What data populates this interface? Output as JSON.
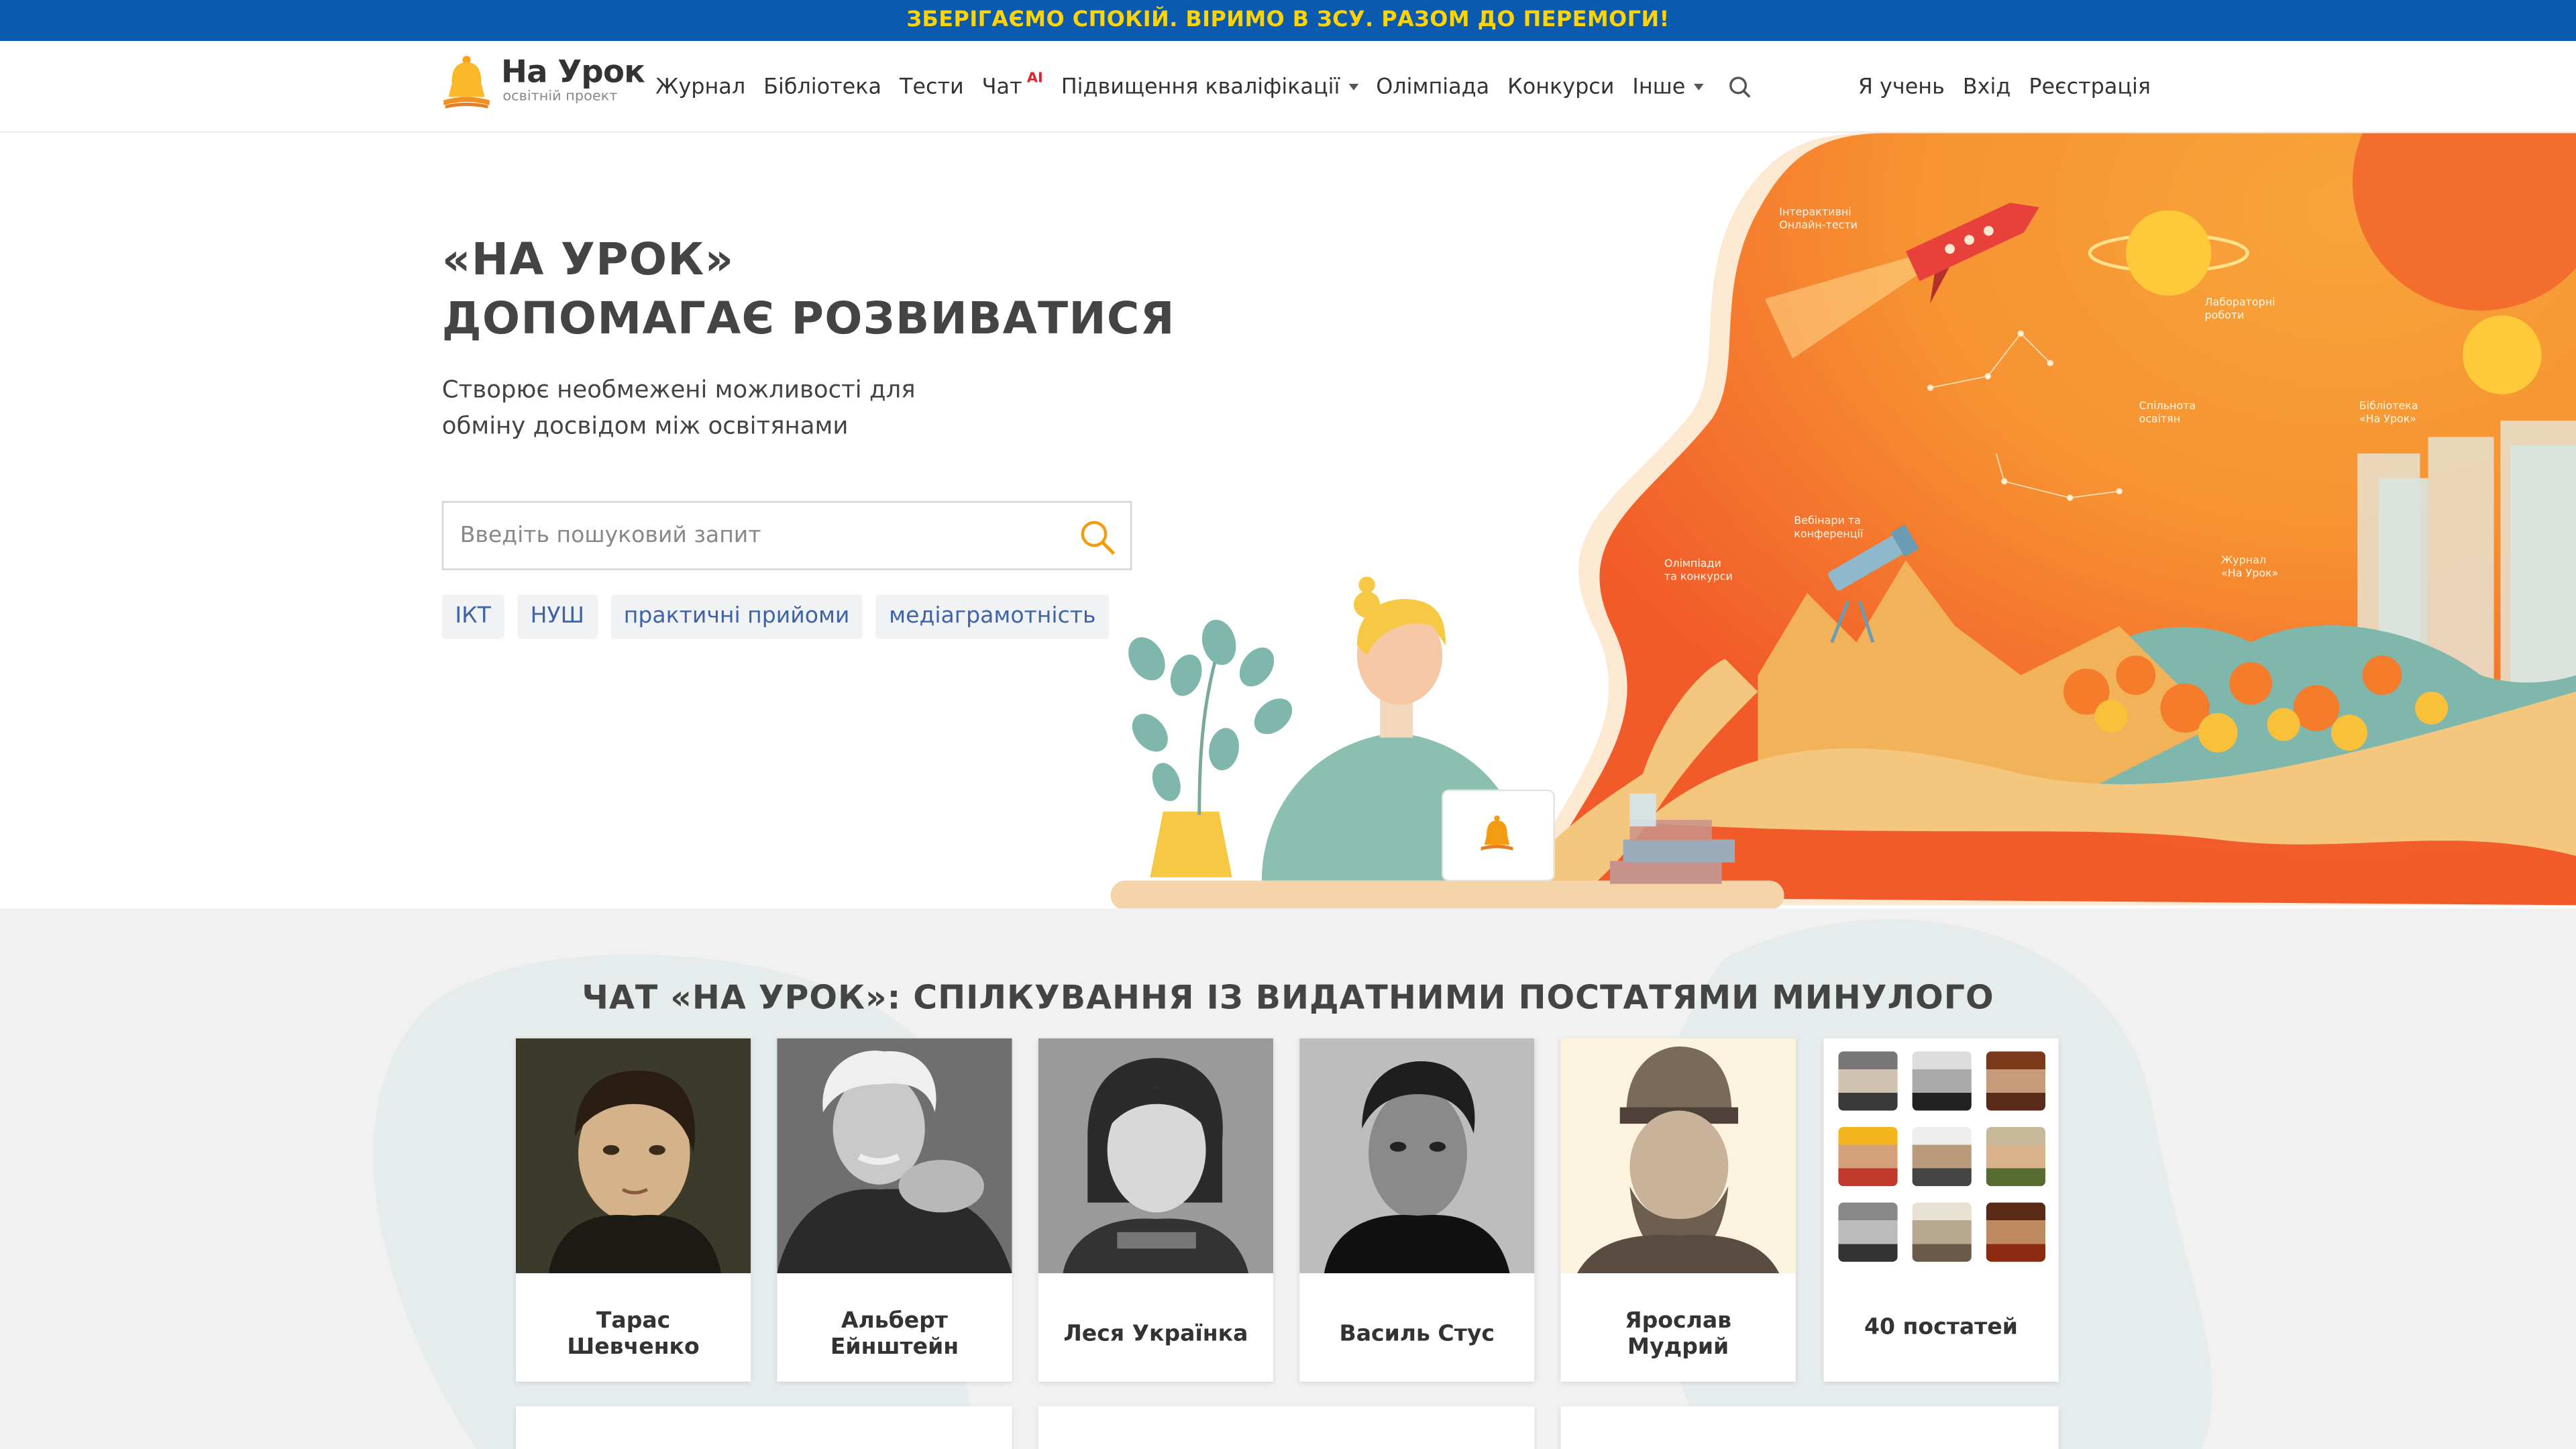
{
  "banner": {
    "text": "ЗБЕРІГАЄМО СПОКІЙ. ВІРИМО В ЗСУ. РАЗОМ ДО ПЕРЕМОГИ!",
    "bg": "#0a5bb0",
    "color": "#ffd400"
  },
  "header": {
    "logo_title": "На Урок",
    "logo_subtitle": "освітній проект",
    "menu": [
      {
        "label": "Журнал"
      },
      {
        "label": "Бібліотека"
      },
      {
        "label": "Тести"
      },
      {
        "label": "Чат",
        "badge": "AI"
      },
      {
        "label": "Підвищення кваліфікації",
        "dropdown": true
      },
      {
        "label": "Олімпіада"
      },
      {
        "label": "Конкурси"
      },
      {
        "label": "Інше",
        "dropdown": true
      }
    ],
    "search_icon": "search-icon",
    "right_menu": [
      "Я учень",
      "Вхід",
      "Реєстрація"
    ]
  },
  "hero": {
    "title_line1": "«НА УРОК»",
    "title_line2": "ДОПОМАГАЄ РОЗВИВАТИСЯ",
    "lead_line1": "Створює необмежені можливості для",
    "lead_line2": "обміну досвідом між освітянами",
    "search_placeholder": "Введіть пошуковий запит",
    "tags": [
      "ІКТ",
      "НУШ",
      "практичні прийоми",
      "медіаграмотність"
    ],
    "illustration_labels": [
      "Інтерактивні",
      "Онлайн-тести",
      "Лабораторні",
      "роботи",
      "Спільнота",
      "освітян",
      "Бібліотека",
      "«На Урок»",
      "Вебінари та",
      "конференції",
      "Олімпіади",
      "та конкурси",
      "Журнал",
      "«На Урок»"
    ]
  },
  "chat_section": {
    "title": "ЧАТ «НА УРОК»: СПІЛКУВАННЯ ІЗ ВИДАТНИМИ ПОСТАТЯМИ МИНУЛОГО",
    "cards": [
      {
        "name": "Тарас Шевченко"
      },
      {
        "name": "Альберт Ейнштейн"
      },
      {
        "name": "Леся Українка"
      },
      {
        "name": "Василь Стус"
      },
      {
        "name": "Ярослав Мудрий"
      },
      {
        "name": "40 постатей"
      }
    ]
  },
  "colors": {
    "accent": "#f7941d",
    "link": "#3e63a6",
    "section_bg": "#f1f1f1"
  }
}
